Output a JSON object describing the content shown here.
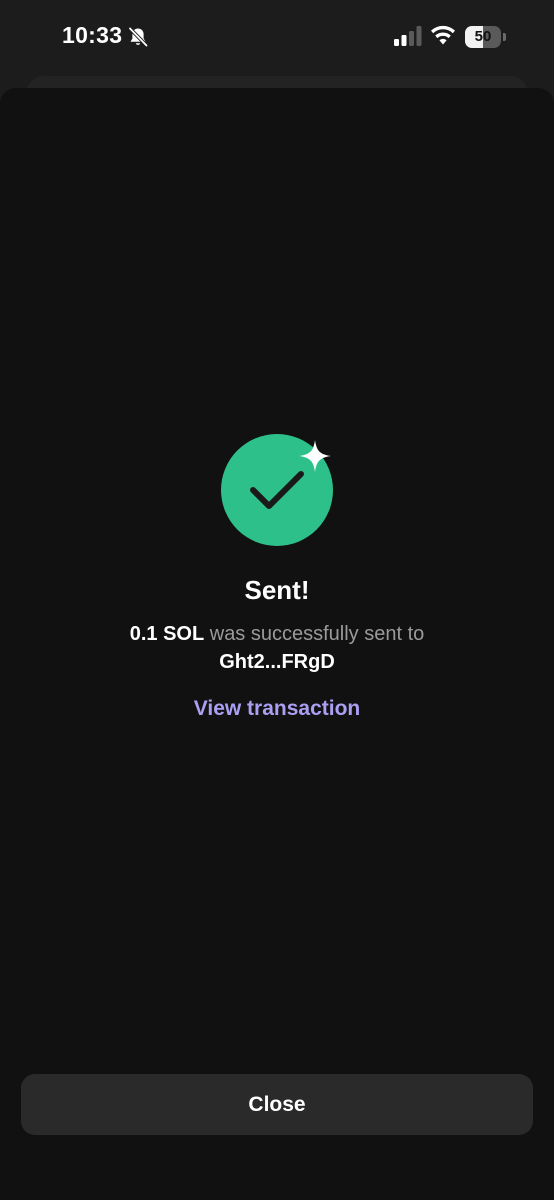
{
  "status_bar": {
    "time": "10:33",
    "battery_level": "50",
    "battery_fraction": 0.5,
    "icons": [
      "bell-slash-icon",
      "cellular-signal-icon",
      "wifi-icon",
      "battery-icon"
    ]
  },
  "result": {
    "icon": "checkmark-circle-icon",
    "sparkle_icon": "sparkle-icon",
    "title": "Sent!",
    "amount": "0.1 SOL",
    "message_middle": " was successfully sent to ",
    "recipient": "Ght2...FRgD",
    "view_link_label": "View transaction"
  },
  "footer": {
    "close_label": "Close"
  },
  "colors": {
    "success_green": "#2ec08b",
    "link_purple": "#ab9ff2",
    "background": "#111111",
    "button_bg": "#2a2a2a"
  }
}
